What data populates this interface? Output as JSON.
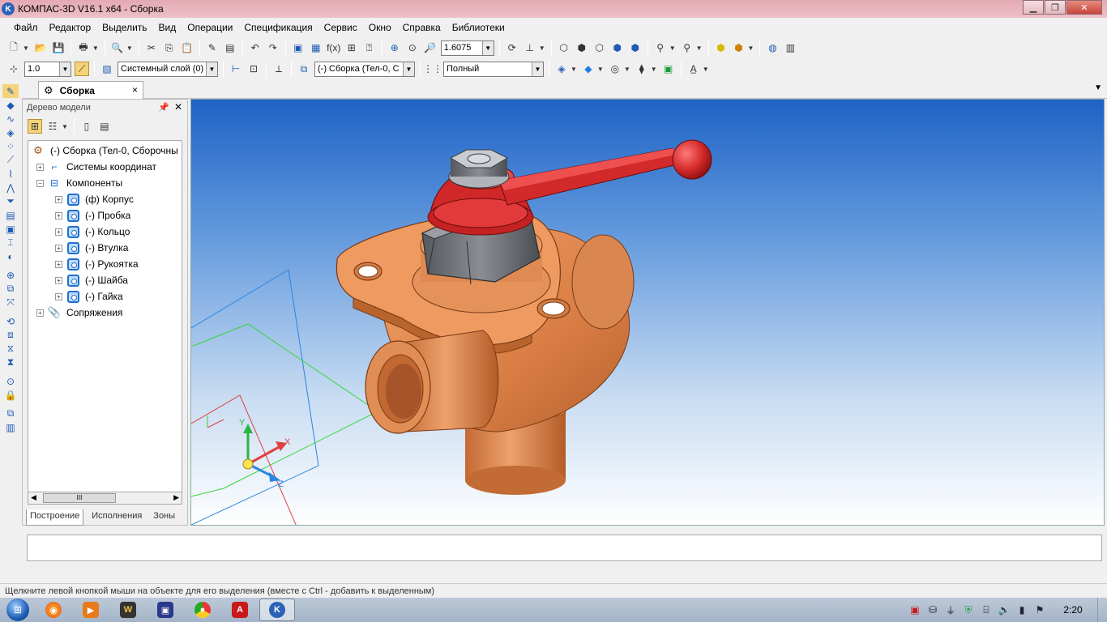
{
  "window": {
    "title": "КОМПАС-3D V16.1 x64 - Сборка",
    "logo_text": "K"
  },
  "menu": [
    "Файл",
    "Редактор",
    "Выделить",
    "Вид",
    "Операции",
    "Спецификация",
    "Сервис",
    "Окно",
    "Справка",
    "Библиотеки"
  ],
  "toolbar1": {
    "zoom_value": "1.6075",
    "fx_label": "f(x)"
  },
  "toolbar2": {
    "step_value": "1.0",
    "layer_value": "Системный слой (0)",
    "assembly_value": "(-) Сборка (Тел-0, С",
    "view_mode_value": "Полный"
  },
  "doc_tab": {
    "label": "Сборка",
    "close": "×"
  },
  "tree_panel": {
    "title": "Дерево модели",
    "root": "(-) Сборка (Тел-0, Сборочны",
    "coords": "Системы координат",
    "components_label": "Компоненты",
    "components": [
      "(ф) Корпус",
      "(-) Пробка",
      "(-) Кольцо",
      "(-) Втулка",
      "(-) Рукоятка",
      "(-) Шайба",
      "(-) Гайка"
    ],
    "mates": "Сопряжения",
    "scroll_thumb": "III",
    "tabs": [
      "Построение",
      "Исполнения",
      "Зоны"
    ]
  },
  "viewport": {
    "axis_x": "X",
    "axis_y": "Y",
    "axis_z": "Z"
  },
  "status": "Щелкните левой кнопкой мыши на объекте для его выделения (вместе с Ctrl - добавить к выделенным)",
  "taskbar": {
    "clock": "2:20"
  },
  "colors": {
    "title_bg": "#eebfc8",
    "part_body": "#e08a55",
    "handle": "#d42a2a",
    "nut": "#6a6d72",
    "viewport_top": "#1d63c6"
  }
}
